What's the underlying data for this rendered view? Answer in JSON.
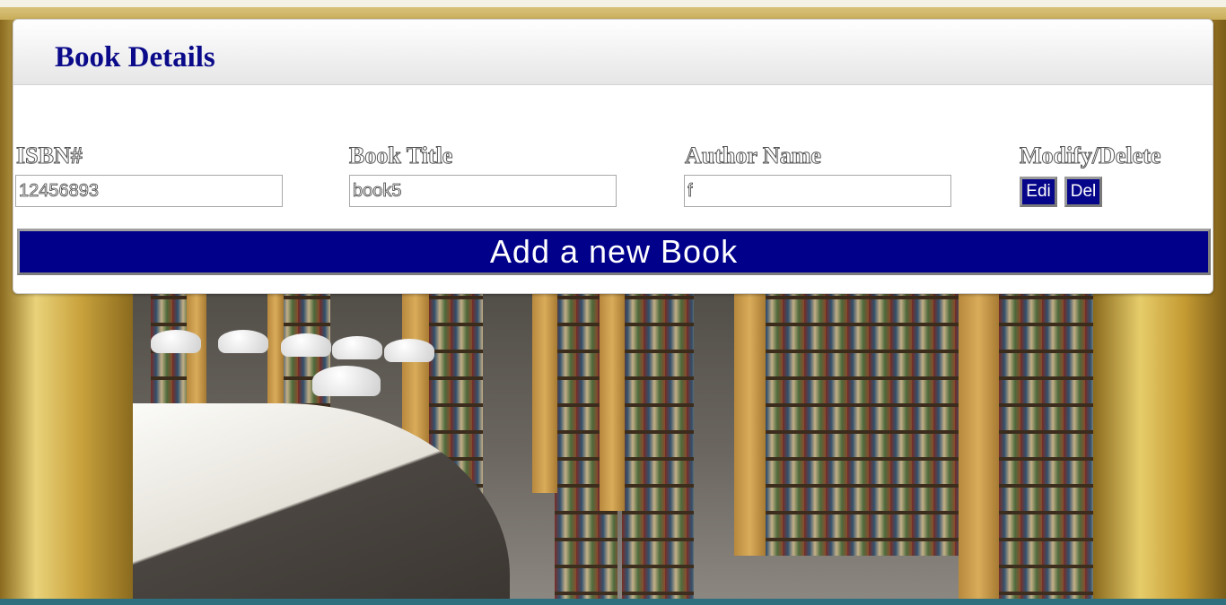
{
  "dialog": {
    "title": "Book Details"
  },
  "form": {
    "isbn_label": "ISBN#",
    "isbn_value": "12456893",
    "title_label": "Book Title",
    "title_value": "book5",
    "author_label": "Author Name",
    "author_value": "f",
    "actions_label": "Modify/Delete",
    "edit_label": "Edi",
    "delete_label": "Del"
  },
  "add_button_label": "Add a new Book",
  "colors": {
    "accent": "#00008B",
    "title": "#0A0A8A"
  }
}
